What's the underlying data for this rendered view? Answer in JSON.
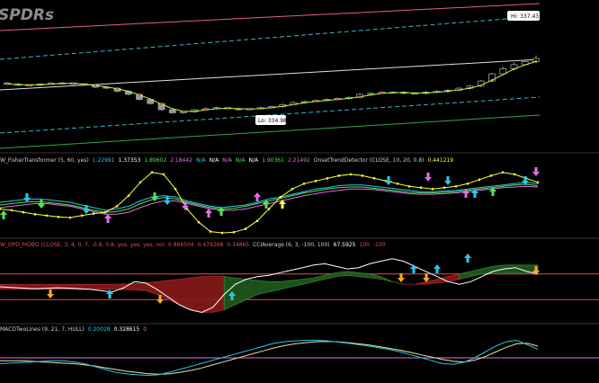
{
  "watermark": "SPDRs",
  "price_panel": {
    "high_label": "Hi: 337.43",
    "low_label": "Lo: 334.98"
  },
  "studies": {
    "fisher": {
      "segments": [
        {
          "text": "W_FisherTransformer (5, 60, yes)",
          "color": "#d0d0d0"
        },
        {
          "text": "1.22991",
          "color": "#29c8e8"
        },
        {
          "text": "1.37353",
          "color": "#ffffff"
        },
        {
          "text": "1.89602",
          "color": "#58e058"
        },
        {
          "text": "2.18442",
          "color": "#e070e0"
        },
        {
          "text": "N/A",
          "color": "#29c8e8"
        },
        {
          "text": "N/A",
          "color": "#ffffff"
        },
        {
          "text": "N/A",
          "color": "#e070e0"
        },
        {
          "text": "N/A",
          "color": "#58e058"
        },
        {
          "text": "N/A",
          "color": "#ffffff"
        },
        {
          "text": "1.90361",
          "color": "#58e058"
        },
        {
          "text": "2.21492",
          "color": "#e070e0"
        },
        {
          "text": "OnsetTrendDetector (CLOSE, 10, 20, 0.8)",
          "color": "#d0d0d0"
        },
        {
          "text": "0.441219",
          "color": "#ffff40"
        }
      ]
    },
    "mobo": {
      "segments": [
        {
          "text": "W_OPD_MOBO (CLOSE, 3, 4, 0, 7, -0.8, 0.8, yes, yes, yes, no)",
          "color": "#e05050"
        },
        {
          "text": "0.866504",
          "color": "#e05050"
        },
        {
          "text": "0.479268",
          "color": "#e05050"
        },
        {
          "text": "0.34865",
          "color": "#e05050"
        },
        {
          "text": "CCIAverage (6, 3, -100, 100)",
          "color": "#d0d0d0"
        },
        {
          "text": "67.5925",
          "color": "#ffffff"
        },
        {
          "text": "100",
          "color": "#e05050"
        },
        {
          "text": "-100",
          "color": "#e05050"
        }
      ]
    },
    "macd": {
      "segments": [
        {
          "text": "MACDTwoLines (9, 21, 7, HULL)",
          "color": "#d0d0d0"
        },
        {
          "text": "0.20028",
          "color": "#29c8e8"
        },
        {
          "text": "0.328615",
          "color": "#ffffff"
        },
        {
          "text": "0",
          "color": "#e070e0"
        }
      ]
    }
  },
  "colors": {
    "upper_band": "#e85c9a",
    "mid_upper": "#2fb8c8",
    "regression": "#e0e0e0",
    "mid_lower": "#2fb8c8",
    "lower_band": "#2ea84a",
    "ma": "#b8ff3a",
    "candle": "#9a9a9a",
    "yellow": "#ffff40",
    "cyan": "#29c8e8",
    "magenta": "#e070e0",
    "green": "#58e058",
    "red_band": "#8a1a1a",
    "green_band": "#1f5a1f",
    "cci_level": "#e05050",
    "macd_zero": "#e070e0",
    "macd_fast": "#29c8e8",
    "macd_slow": "#f0e0a0"
  },
  "chart_data": {
    "type": "line",
    "price": {
      "open": [
        48,
        47,
        46,
        46,
        47,
        48,
        48,
        47,
        46,
        44,
        43,
        40,
        37,
        32,
        28,
        22,
        19,
        20,
        22,
        23,
        24,
        23,
        22,
        23,
        24,
        25,
        27,
        29,
        30,
        31,
        32,
        33,
        34,
        37,
        38,
        39,
        39,
        38,
        38,
        39,
        40,
        41,
        43,
        45,
        50,
        57,
        62,
        66,
        69
      ],
      "close": [
        47,
        46,
        46,
        47,
        48,
        48,
        47,
        46,
        44,
        43,
        40,
        37,
        32,
        28,
        22,
        19,
        20,
        22,
        23,
        24,
        23,
        22,
        23,
        24,
        25,
        27,
        29,
        30,
        31,
        32,
        33,
        34,
        37,
        38,
        39,
        39,
        38,
        38,
        39,
        40,
        41,
        43,
        45,
        50,
        57,
        62,
        66,
        69,
        72
      ],
      "high": [
        49,
        48,
        47,
        48,
        49,
        49,
        49,
        48,
        47,
        45,
        44,
        41,
        38,
        33,
        29,
        23,
        21,
        23,
        24,
        25,
        25,
        24,
        24,
        25,
        26,
        28,
        30,
        31,
        32,
        33,
        34,
        35,
        38,
        39,
        40,
        40,
        40,
        39,
        40,
        41,
        42,
        44,
        46,
        51,
        58,
        64,
        68,
        71,
        75
      ],
      "low": [
        46,
        45,
        45,
        45,
        46,
        47,
        46,
        45,
        43,
        42,
        39,
        36,
        31,
        27,
        21,
        18,
        18,
        19,
        21,
        22,
        22,
        21,
        21,
        22,
        23,
        24,
        26,
        28,
        29,
        30,
        31,
        32,
        33,
        36,
        37,
        38,
        37,
        37,
        37,
        38,
        39,
        40,
        42,
        44,
        49,
        56,
        61,
        65,
        68
      ],
      "ylim": [
        0,
        100
      ]
    },
    "fisher_osc": {
      "yellow": [
        40,
        38,
        35,
        32,
        30,
        28,
        27,
        30,
        33,
        35,
        44,
        60,
        80,
        95,
        92,
        70,
        40,
        20,
        6,
        4,
        5,
        10,
        22,
        40,
        58,
        70,
        78,
        82,
        86,
        90,
        92,
        90,
        86,
        82,
        78,
        74,
        72,
        70,
        72,
        74,
        78,
        84,
        90,
        95,
        92,
        86,
        80
      ],
      "cyan": [
        50,
        52,
        54,
        55,
        54,
        52,
        50,
        46,
        42,
        38,
        40,
        44,
        52,
        58,
        60,
        58,
        52,
        48,
        44,
        42,
        44,
        46,
        50,
        55,
        58,
        62,
        66,
        70,
        72,
        75,
        76,
        76,
        74,
        72,
        70,
        68,
        66,
        66,
        67,
        68,
        70,
        72,
        74,
        76,
        78,
        80,
        78
      ],
      "green": [
        46,
        48,
        50,
        51,
        50,
        48,
        46,
        42,
        38,
        35,
        36,
        40,
        48,
        54,
        57,
        55,
        50,
        46,
        42,
        40,
        41,
        44,
        48,
        52,
        56,
        60,
        64,
        67,
        70,
        72,
        73,
        73,
        71,
        69,
        67,
        65,
        64,
        64,
        65,
        66,
        68,
        70,
        72,
        74,
        76,
        77,
        75
      ],
      "magenta": [
        42,
        44,
        46,
        48,
        48,
        46,
        44,
        40,
        36,
        32,
        32,
        35,
        42,
        48,
        52,
        52,
        48,
        44,
        40,
        38,
        38,
        40,
        44,
        48,
        52,
        56,
        60,
        63,
        66,
        68,
        70,
        70,
        69,
        67,
        65,
        63,
        62,
        62,
        63,
        64,
        66,
        68,
        70,
        72,
        73,
        74,
        73
      ],
      "ylim": [
        0,
        100
      ]
    },
    "mobo_cci": {
      "cci": [
        0,
        -5,
        -10,
        -15,
        -12,
        -8,
        -10,
        -15,
        -20,
        -30,
        -40,
        -10,
        40,
        30,
        -20,
        -80,
        -140,
        -180,
        -200,
        -160,
        -60,
        20,
        60,
        80,
        90,
        110,
        130,
        150,
        170,
        180,
        160,
        140,
        150,
        180,
        200,
        220,
        200,
        160,
        120,
        80,
        40,
        20,
        40,
        80,
        120,
        140,
        150,
        120,
        100
      ],
      "upper_band": [
        20,
        20,
        20,
        20,
        20,
        20,
        20,
        20,
        20,
        20,
        20,
        22,
        25,
        30,
        40,
        50,
        60,
        70,
        80,
        80,
        80,
        70,
        60,
        50,
        40,
        40,
        50,
        60,
        70,
        90,
        110,
        120,
        110,
        100,
        80,
        40,
        20,
        20,
        40,
        60,
        80,
        100,
        120,
        140,
        160,
        170,
        170,
        170,
        170
      ],
      "lower_band": [
        -20,
        -20,
        -20,
        -20,
        -20,
        -20,
        -20,
        -20,
        -20,
        -20,
        -20,
        -22,
        -25,
        -30,
        -60,
        -100,
        -140,
        -180,
        -200,
        -200,
        -180,
        -140,
        -100,
        -60,
        -40,
        -20,
        0,
        20,
        40,
        60,
        80,
        90,
        80,
        70,
        60,
        40,
        20,
        20,
        20,
        30,
        40,
        60,
        80,
        100,
        110,
        110,
        110,
        110,
        110
      ],
      "ylim": [
        -260,
        260
      ]
    },
    "macd": {
      "fast": [
        -20,
        -18,
        -16,
        -14,
        -12,
        -10,
        -10,
        -14,
        -20,
        -30,
        -40,
        -50,
        -55,
        -58,
        -60,
        -58,
        -50,
        -40,
        -30,
        -20,
        -10,
        0,
        10,
        20,
        30,
        40,
        50,
        55,
        58,
        60,
        60,
        58,
        54,
        50,
        45,
        40,
        34,
        28,
        20,
        10,
        0,
        -10,
        -20,
        -22,
        -15,
        0,
        20,
        40,
        55,
        60,
        45,
        30
      ],
      "slow": [
        -10,
        -10,
        -10,
        -12,
        -14,
        -16,
        -18,
        -20,
        -24,
        -28,
        -34,
        -40,
        -46,
        -50,
        -54,
        -56,
        -55,
        -50,
        -44,
        -36,
        -26,
        -16,
        -6,
        4,
        14,
        24,
        34,
        42,
        48,
        52,
        55,
        56,
        55,
        52,
        48,
        44,
        38,
        32,
        26,
        18,
        10,
        2,
        -6,
        -12,
        -14,
        -8,
        4,
        20,
        36,
        48,
        50,
        40
      ],
      "ylim": [
        -80,
        80
      ]
    }
  }
}
